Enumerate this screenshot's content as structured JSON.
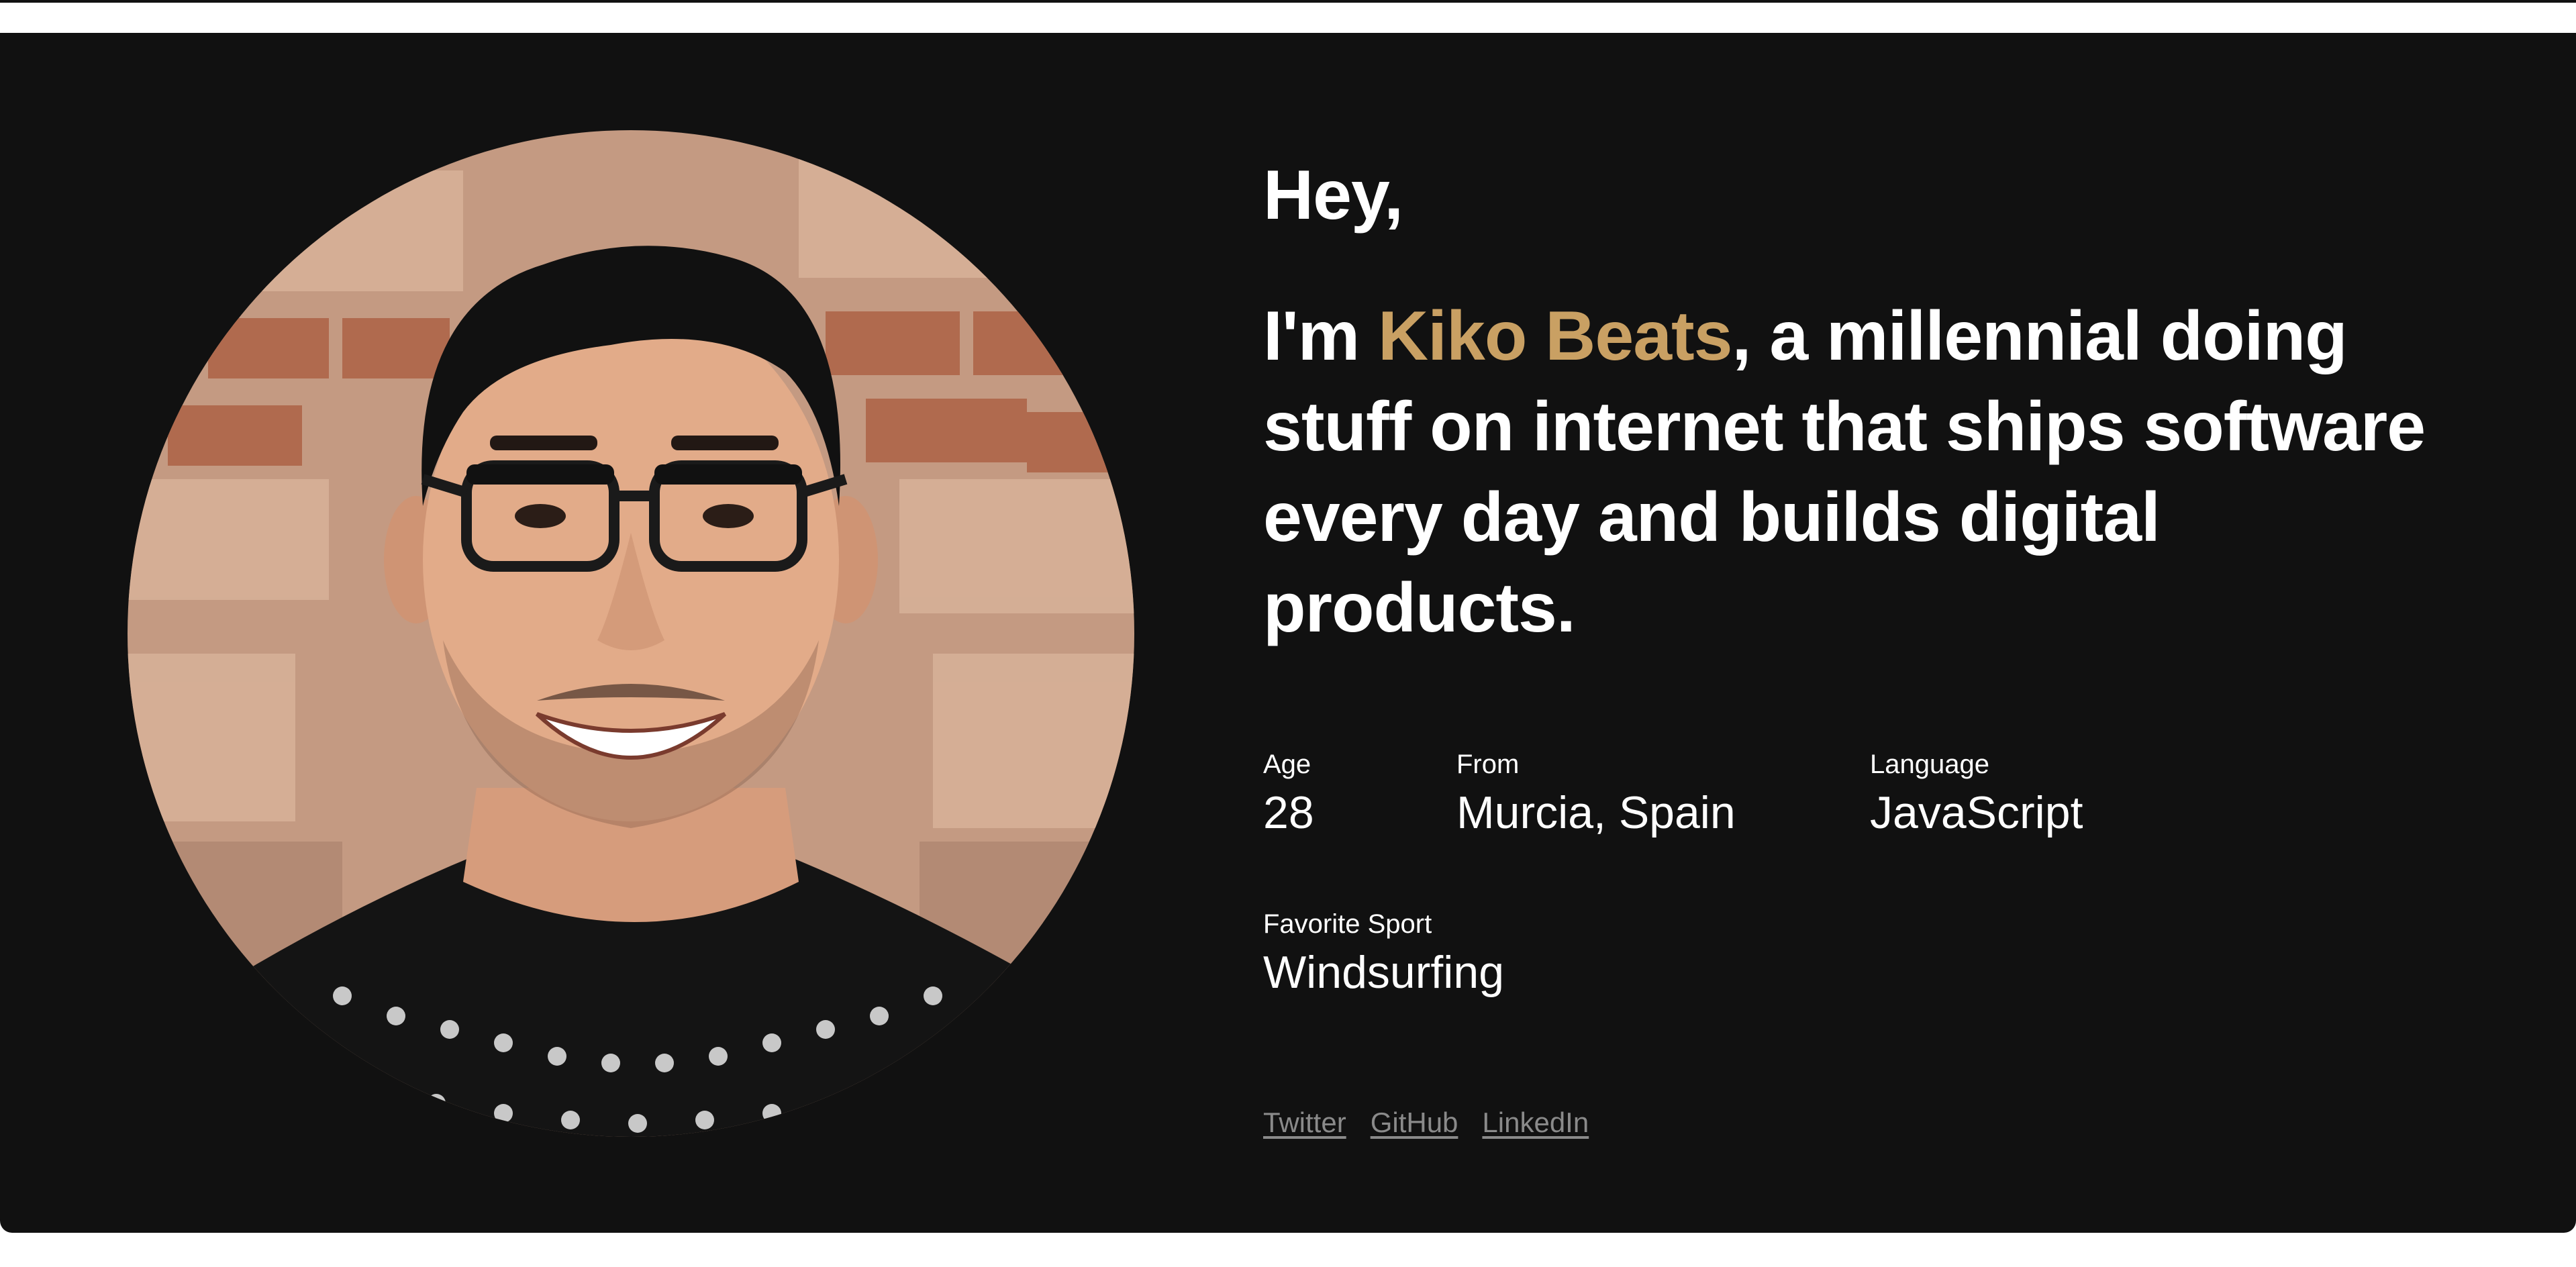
{
  "hero": {
    "greeting": "Hey,",
    "intro_prefix": "I'm ",
    "name": "Kiko Beats",
    "intro_suffix": ", a millennial doing stuff on internet that ships software every day and builds digital products."
  },
  "facts": [
    {
      "label": "Age",
      "value": "28"
    },
    {
      "label": "From",
      "value": "Murcia, Spain"
    },
    {
      "label": "Language",
      "value": "JavaScript"
    },
    {
      "label": "Favorite Sport",
      "value": "Windsurfing"
    }
  ],
  "links": [
    {
      "label": "Twitter"
    },
    {
      "label": "GitHub"
    },
    {
      "label": "LinkedIn"
    }
  ],
  "colors": {
    "background": "#111111",
    "accent": "#c9a063",
    "text": "#ffffff",
    "link": "#8a8a8a"
  }
}
